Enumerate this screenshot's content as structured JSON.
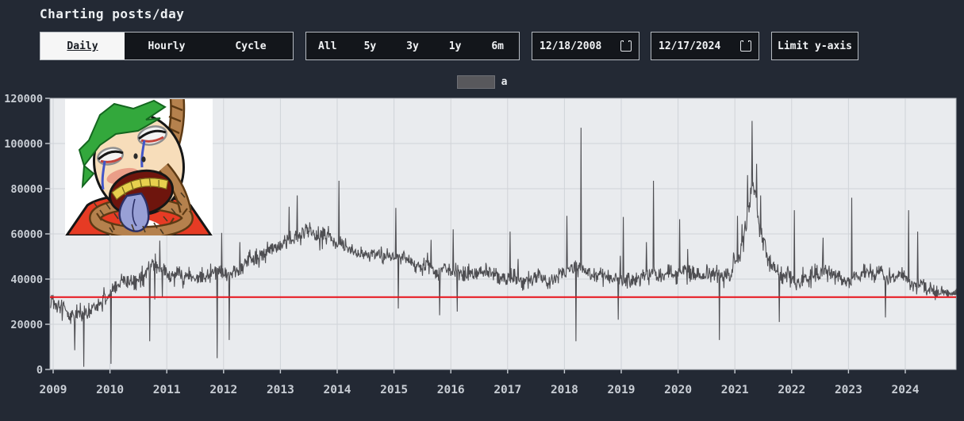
{
  "header": {
    "title": "Charting posts/day"
  },
  "controls": {
    "view_tabs": [
      {
        "label": "Daily",
        "selected": true
      },
      {
        "label": "Hourly",
        "selected": false
      },
      {
        "label": "Cycle",
        "selected": false
      }
    ],
    "range_buttons": [
      "All",
      "5y",
      "3y",
      "1y",
      "6m"
    ],
    "date_from": "12/18/2008",
    "date_to": "12/17/2024",
    "limit_y_button": "Limit y-axis"
  },
  "legend": {
    "series_label": "a",
    "swatch_color": "#58585c"
  },
  "overlay_image": {
    "description": "crying green-haired soyjak meme with noose, red shirt, tongue out"
  },
  "chart_data": {
    "type": "line",
    "title": "Charting posts/day",
    "xlabel": "",
    "ylabel": "",
    "x_start_date": "12/18/2008",
    "x_end_date": "12/17/2024",
    "x_tick_labels": [
      "2009",
      "2010",
      "2011",
      "2012",
      "2013",
      "2014",
      "2015",
      "2016",
      "2017",
      "2018",
      "2019",
      "2020",
      "2021",
      "2022",
      "2023",
      "2024"
    ],
    "y_tick_labels": [
      "0",
      "20000",
      "40000",
      "60000",
      "80000",
      "100000",
      "120000"
    ],
    "y_range": [
      0,
      120000
    ],
    "grid": true,
    "plot_bg": "#e9ebee",
    "grid_color": "#d0d3d8",
    "tick_color": "#c9ced5",
    "series": [
      {
        "name": "a",
        "color": "#4e4e52"
      }
    ],
    "reference_line": {
      "value": 32000,
      "color": "#e8131a"
    },
    "seed": 7,
    "points": 1800,
    "trend_anchors": [
      [
        2008.955,
        31000
      ],
      [
        2009.2,
        27000
      ],
      [
        2009.5,
        26500
      ],
      [
        2009.8,
        30000
      ],
      [
        2010.0,
        33000
      ],
      [
        2010.3,
        40000
      ],
      [
        2010.6,
        44000
      ],
      [
        2010.85,
        48000
      ],
      [
        2011.1,
        42000
      ],
      [
        2011.3,
        38500
      ],
      [
        2011.6,
        41000
      ],
      [
        2011.9,
        44000
      ],
      [
        2012.1,
        44000
      ],
      [
        2012.4,
        47000
      ],
      [
        2012.7,
        51000
      ],
      [
        2013.0,
        56000
      ],
      [
        2013.25,
        62000
      ],
      [
        2013.5,
        63000
      ],
      [
        2013.75,
        59000
      ],
      [
        2014.0,
        57000
      ],
      [
        2014.3,
        54000
      ],
      [
        2014.7,
        51000
      ],
      [
        2015.0,
        50000
      ],
      [
        2015.4,
        47000
      ],
      [
        2015.8,
        46000
      ],
      [
        2016.2,
        44500
      ],
      [
        2016.6,
        43000
      ],
      [
        2017.0,
        42000
      ],
      [
        2017.4,
        42500
      ],
      [
        2017.8,
        42000
      ],
      [
        2018.1,
        43500
      ],
      [
        2018.35,
        45000
      ],
      [
        2018.6,
        42000
      ],
      [
        2019.0,
        41500
      ],
      [
        2019.4,
        40500
      ],
      [
        2019.8,
        39500
      ],
      [
        2020.2,
        39500
      ],
      [
        2020.6,
        40500
      ],
      [
        2020.9,
        43000
      ],
      [
        2021.1,
        52000
      ],
      [
        2021.25,
        68000
      ],
      [
        2021.32,
        80000
      ],
      [
        2021.45,
        58000
      ],
      [
        2021.6,
        47000
      ],
      [
        2021.8,
        42500
      ],
      [
        2022.1,
        39500
      ],
      [
        2022.5,
        41000
      ],
      [
        2022.9,
        40000
      ],
      [
        2023.3,
        41500
      ],
      [
        2023.7,
        40000
      ],
      [
        2024.0,
        39000
      ],
      [
        2024.4,
        37500
      ],
      [
        2024.7,
        35500
      ],
      [
        2024.9,
        33500
      ]
    ],
    "noise_amp_anchors": [
      [
        2008.955,
        5200
      ],
      [
        2010.5,
        5000
      ],
      [
        2011.5,
        4600
      ],
      [
        2013.0,
        4800
      ],
      [
        2014.0,
        4500
      ],
      [
        2016.0,
        3900
      ],
      [
        2018.0,
        4200
      ],
      [
        2020.0,
        4300
      ],
      [
        2021.2,
        6000
      ],
      [
        2021.6,
        4500
      ],
      [
        2023.0,
        4100
      ],
      [
        2024.9,
        3800
      ]
    ],
    "events": [
      [
        2009.38,
        8500
      ],
      [
        2009.54,
        1200
      ],
      [
        2010.02,
        2500
      ],
      [
        2010.7,
        12500
      ],
      [
        2010.88,
        57000
      ],
      [
        2011.89,
        5000
      ],
      [
        2012.1,
        13000
      ],
      [
        2013.15,
        72000
      ],
      [
        2013.3,
        77000
      ],
      [
        2014.03,
        83500
      ],
      [
        2015.03,
        71500
      ],
      [
        2015.08,
        27000
      ],
      [
        2015.8,
        24000
      ],
      [
        2016.04,
        62000
      ],
      [
        2017.04,
        61000
      ],
      [
        2018.04,
        68000
      ],
      [
        2018.2,
        12500
      ],
      [
        2018.29,
        107000
      ],
      [
        2018.95,
        22000
      ],
      [
        2019.04,
        67500
      ],
      [
        2019.57,
        83500
      ],
      [
        2020.03,
        66500
      ],
      [
        2020.73,
        13000
      ],
      [
        2021.05,
        68000
      ],
      [
        2021.22,
        86000
      ],
      [
        2021.3,
        110000
      ],
      [
        2021.38,
        91000
      ],
      [
        2021.45,
        77000
      ],
      [
        2021.78,
        21000
      ],
      [
        2022.05,
        70500
      ],
      [
        2023.06,
        76000
      ],
      [
        2023.65,
        23000
      ],
      [
        2024.06,
        70500
      ],
      [
        2024.22,
        61000
      ]
    ]
  }
}
